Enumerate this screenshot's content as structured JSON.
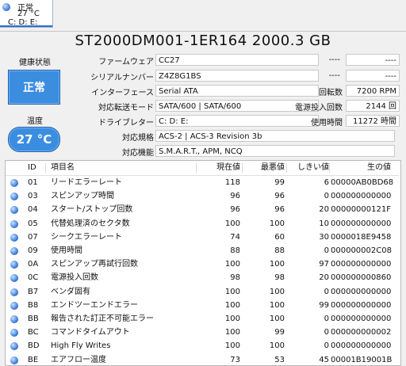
{
  "disk_tab": {
    "status": "正常",
    "temp": "27 °C",
    "letters": "C: D: E:"
  },
  "title": "ST2000DM001-1ER164 2000.3 GB",
  "health": {
    "label": "健康状態",
    "value": "正常"
  },
  "temperature": {
    "label": "温度",
    "value": "27 °C"
  },
  "info": {
    "firmware": {
      "label": "ファームウェア",
      "value": "CC27"
    },
    "serial": {
      "label": "シリアルナンバー",
      "value": "Z4Z8G1BS"
    },
    "interface": {
      "label": "インターフェース",
      "value": "Serial ATA"
    },
    "transfer": {
      "label": "対応転送モード",
      "value": "SATA/600 | SATA/600"
    },
    "drive": {
      "label": "ドライブレター",
      "value": "C: D: E:"
    },
    "standard": {
      "label": "対応規格",
      "value": "ACS-2 | ACS-3 Revision 3b"
    },
    "features": {
      "label": "対応機能",
      "value": "S.M.A.R.T., APM, NCQ"
    }
  },
  "right_info": {
    "dash1a": "----",
    "dash1b": "----",
    "dash2a": "----",
    "dash2b": "----",
    "rotation": {
      "label": "回転数",
      "value": "7200 RPM"
    },
    "power_count": {
      "label": "電源投入回数",
      "value": "2144 回"
    },
    "power_hours": {
      "label": "使用時間",
      "value": "11272 時間"
    }
  },
  "table": {
    "headers": {
      "id": "ID",
      "name": "項目名",
      "current": "現在値",
      "worst": "最悪値",
      "threshold": "しきい値",
      "raw": "生の値"
    },
    "rows": [
      {
        "id": "01",
        "name": "リードエラーレート",
        "current": "118",
        "worst": "99",
        "threshold": "6",
        "raw": "00000AB0BD68"
      },
      {
        "id": "03",
        "name": "スピンアップ時間",
        "current": "96",
        "worst": "96",
        "threshold": "0",
        "raw": "000000000000"
      },
      {
        "id": "04",
        "name": "スタート/ストップ回数",
        "current": "96",
        "worst": "96",
        "threshold": "20",
        "raw": "00000000121F"
      },
      {
        "id": "05",
        "name": "代替処理済のセクタ数",
        "current": "100",
        "worst": "100",
        "threshold": "10",
        "raw": "000000000000"
      },
      {
        "id": "07",
        "name": "シークエラーレート",
        "current": "74",
        "worst": "60",
        "threshold": "30",
        "raw": "0000018E9458"
      },
      {
        "id": "09",
        "name": "使用時間",
        "current": "88",
        "worst": "88",
        "threshold": "0",
        "raw": "000000002C08"
      },
      {
        "id": "0A",
        "name": "スピンアップ再試行回数",
        "current": "100",
        "worst": "100",
        "threshold": "97",
        "raw": "000000000000"
      },
      {
        "id": "0C",
        "name": "電源投入回数",
        "current": "98",
        "worst": "98",
        "threshold": "20",
        "raw": "000000000860"
      },
      {
        "id": "B7",
        "name": "ベンダ固有",
        "current": "100",
        "worst": "100",
        "threshold": "0",
        "raw": "000000000000"
      },
      {
        "id": "B8",
        "name": "エンドツーエンドエラー",
        "current": "100",
        "worst": "100",
        "threshold": "99",
        "raw": "000000000000"
      },
      {
        "id": "BB",
        "name": "報告された訂正不可能エラー",
        "current": "100",
        "worst": "100",
        "threshold": "0",
        "raw": "000000000000"
      },
      {
        "id": "BC",
        "name": "コマンドタイムアウト",
        "current": "100",
        "worst": "99",
        "threshold": "0",
        "raw": "000000000002"
      },
      {
        "id": "BD",
        "name": "High Fly Writes",
        "current": "100",
        "worst": "100",
        "threshold": "0",
        "raw": "000000000000"
      },
      {
        "id": "BE",
        "name": "エアフロー温度",
        "current": "73",
        "worst": "53",
        "threshold": "45",
        "raw": "00001B19001B"
      }
    ]
  }
}
